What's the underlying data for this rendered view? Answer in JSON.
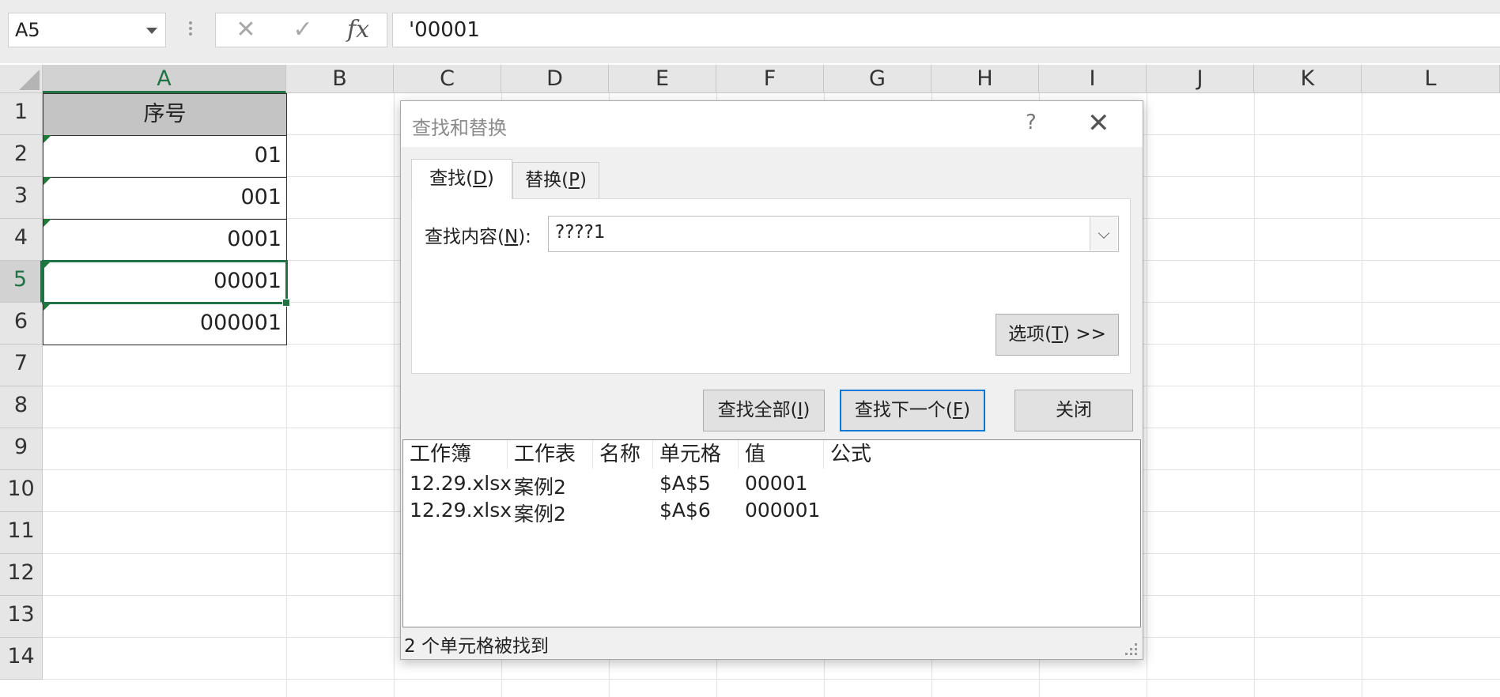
{
  "formula_bar": {
    "name_box": "A5",
    "cancel_icon": "✕",
    "confirm_icon": "✓",
    "fx_label": "fx",
    "formula": "'00001"
  },
  "columns": [
    "A",
    "B",
    "C",
    "D",
    "E",
    "F",
    "G",
    "H",
    "I",
    "J",
    "K",
    "L"
  ],
  "rows": [
    "1",
    "2",
    "3",
    "4",
    "5",
    "6",
    "7",
    "8",
    "9",
    "10",
    "11",
    "12",
    "13",
    "14"
  ],
  "selected_column": "A",
  "selected_row": "5",
  "sheet_cells": {
    "header": "序号",
    "values": [
      "01",
      "001",
      "0001",
      "00001",
      "000001"
    ]
  },
  "dialog": {
    "title": "查找和替换",
    "help": "?",
    "close": "✕",
    "tabs": [
      {
        "label": "查找(",
        "key": "D",
        "suffix": ")"
      },
      {
        "label": "替换(",
        "key": "P",
        "suffix": ")"
      }
    ],
    "find_label": {
      "label": "查找内容(",
      "key": "N",
      "suffix": "):"
    },
    "find_value": "????1",
    "options_button": {
      "label": "选项(",
      "key": "T",
      "suffix": ") >>"
    },
    "find_all_button": {
      "label": "查找全部(",
      "key": "I",
      "suffix": ")"
    },
    "find_next_button": {
      "label": "查找下一个(",
      "key": "F",
      "suffix": ")"
    },
    "close_button": "关闭",
    "result_headers": [
      "工作簿",
      "工作表",
      "名称",
      "单元格",
      "值",
      "公式"
    ],
    "results": [
      {
        "workbook": "12.29.xlsx",
        "sheet": "案例2",
        "name": "",
        "cell": "$A$5",
        "value": "00001",
        "formula": ""
      },
      {
        "workbook": "12.29.xlsx",
        "sheet": "案例2",
        "name": "",
        "cell": "$A$6",
        "value": "000001",
        "formula": ""
      }
    ],
    "status": "2 个单元格被找到"
  }
}
